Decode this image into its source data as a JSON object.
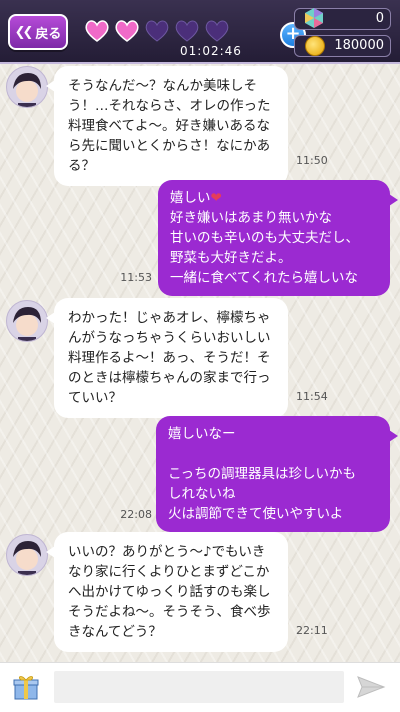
{
  "header": {
    "back_label": "戻る",
    "hearts": {
      "filled": 2,
      "total": 5,
      "filled_color": "#f06ac8",
      "empty_color": "#4b2f7a"
    },
    "timer": "01:02:46",
    "gems": "0",
    "coins": "180000"
  },
  "messages": [
    {
      "side": "in",
      "text": "そうなんだ～？なんか美味しそう！…それならさ、オレの作った料理食べてよ～。好き嫌いあるなら先に聞いとくからさ！なにかある？",
      "time": "11:50"
    },
    {
      "side": "out",
      "line1": "嬉しい",
      "rest": "好き嫌いはあまり無いかな\n甘いのも辛いのも大丈夫だし、\n野菜も大好きだよ。\n一緒に食べてくれたら嬉しいな",
      "time": "11:53"
    },
    {
      "side": "in",
      "text": "わかった！じゃあオレ、檸檬ちゃんがうなっちゃうくらいおいしい料理作るよ～！あっ、そうだ！そのときは檸檬ちゃんの家まで行っていい？",
      "time": "11:54"
    },
    {
      "side": "out",
      "text": "嬉しいなー\n\nこっちの調理器具は珍しいかも\nしれないね\n火は調節できて使いやすいよ",
      "time": "22:08"
    },
    {
      "side": "in",
      "text": "いいの？ありがとう～♪でもいきなり家に行くよりひとまずどこかへ出かけてゆっくり話すのも楽しそうだよね～。そうそう、食べ歩きなんてどう？",
      "time": "22:11"
    }
  ],
  "footer": {
    "input_placeholder": "",
    "icons": {
      "gift": "gift-icon",
      "send": "send-icon"
    }
  },
  "colors": {
    "bubble_out": "#9b2ad1",
    "bubble_in": "#ffffff",
    "back_button": "#9a36c4"
  }
}
